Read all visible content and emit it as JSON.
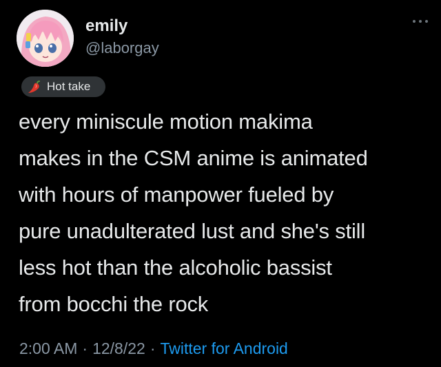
{
  "author": {
    "display_name": "emily",
    "handle": "@laborgay",
    "avatar_icon": "anime-girl-pink-hair-avatar"
  },
  "more_menu_icon": "ellipsis-icon",
  "tag": {
    "icon": "chili-pepper-icon",
    "label": "Hot take"
  },
  "tweet": {
    "text": "every miniscule motion makima\nmakes in the CSM anime is animated\nwith hours of manpower fueled by\npure unadulterated lust and she's still\nless hot than the alcoholic bassist\nfrom bocchi the rock"
  },
  "meta": {
    "time": "2:00 AM",
    "separator": "·",
    "date": "12/8/22",
    "source": "Twitter for Android"
  },
  "colors": {
    "background": "#000000",
    "text": "#e7e9ea",
    "secondary": "#8b98a5",
    "link": "#1d9bf0",
    "pill": "#2f3336"
  }
}
